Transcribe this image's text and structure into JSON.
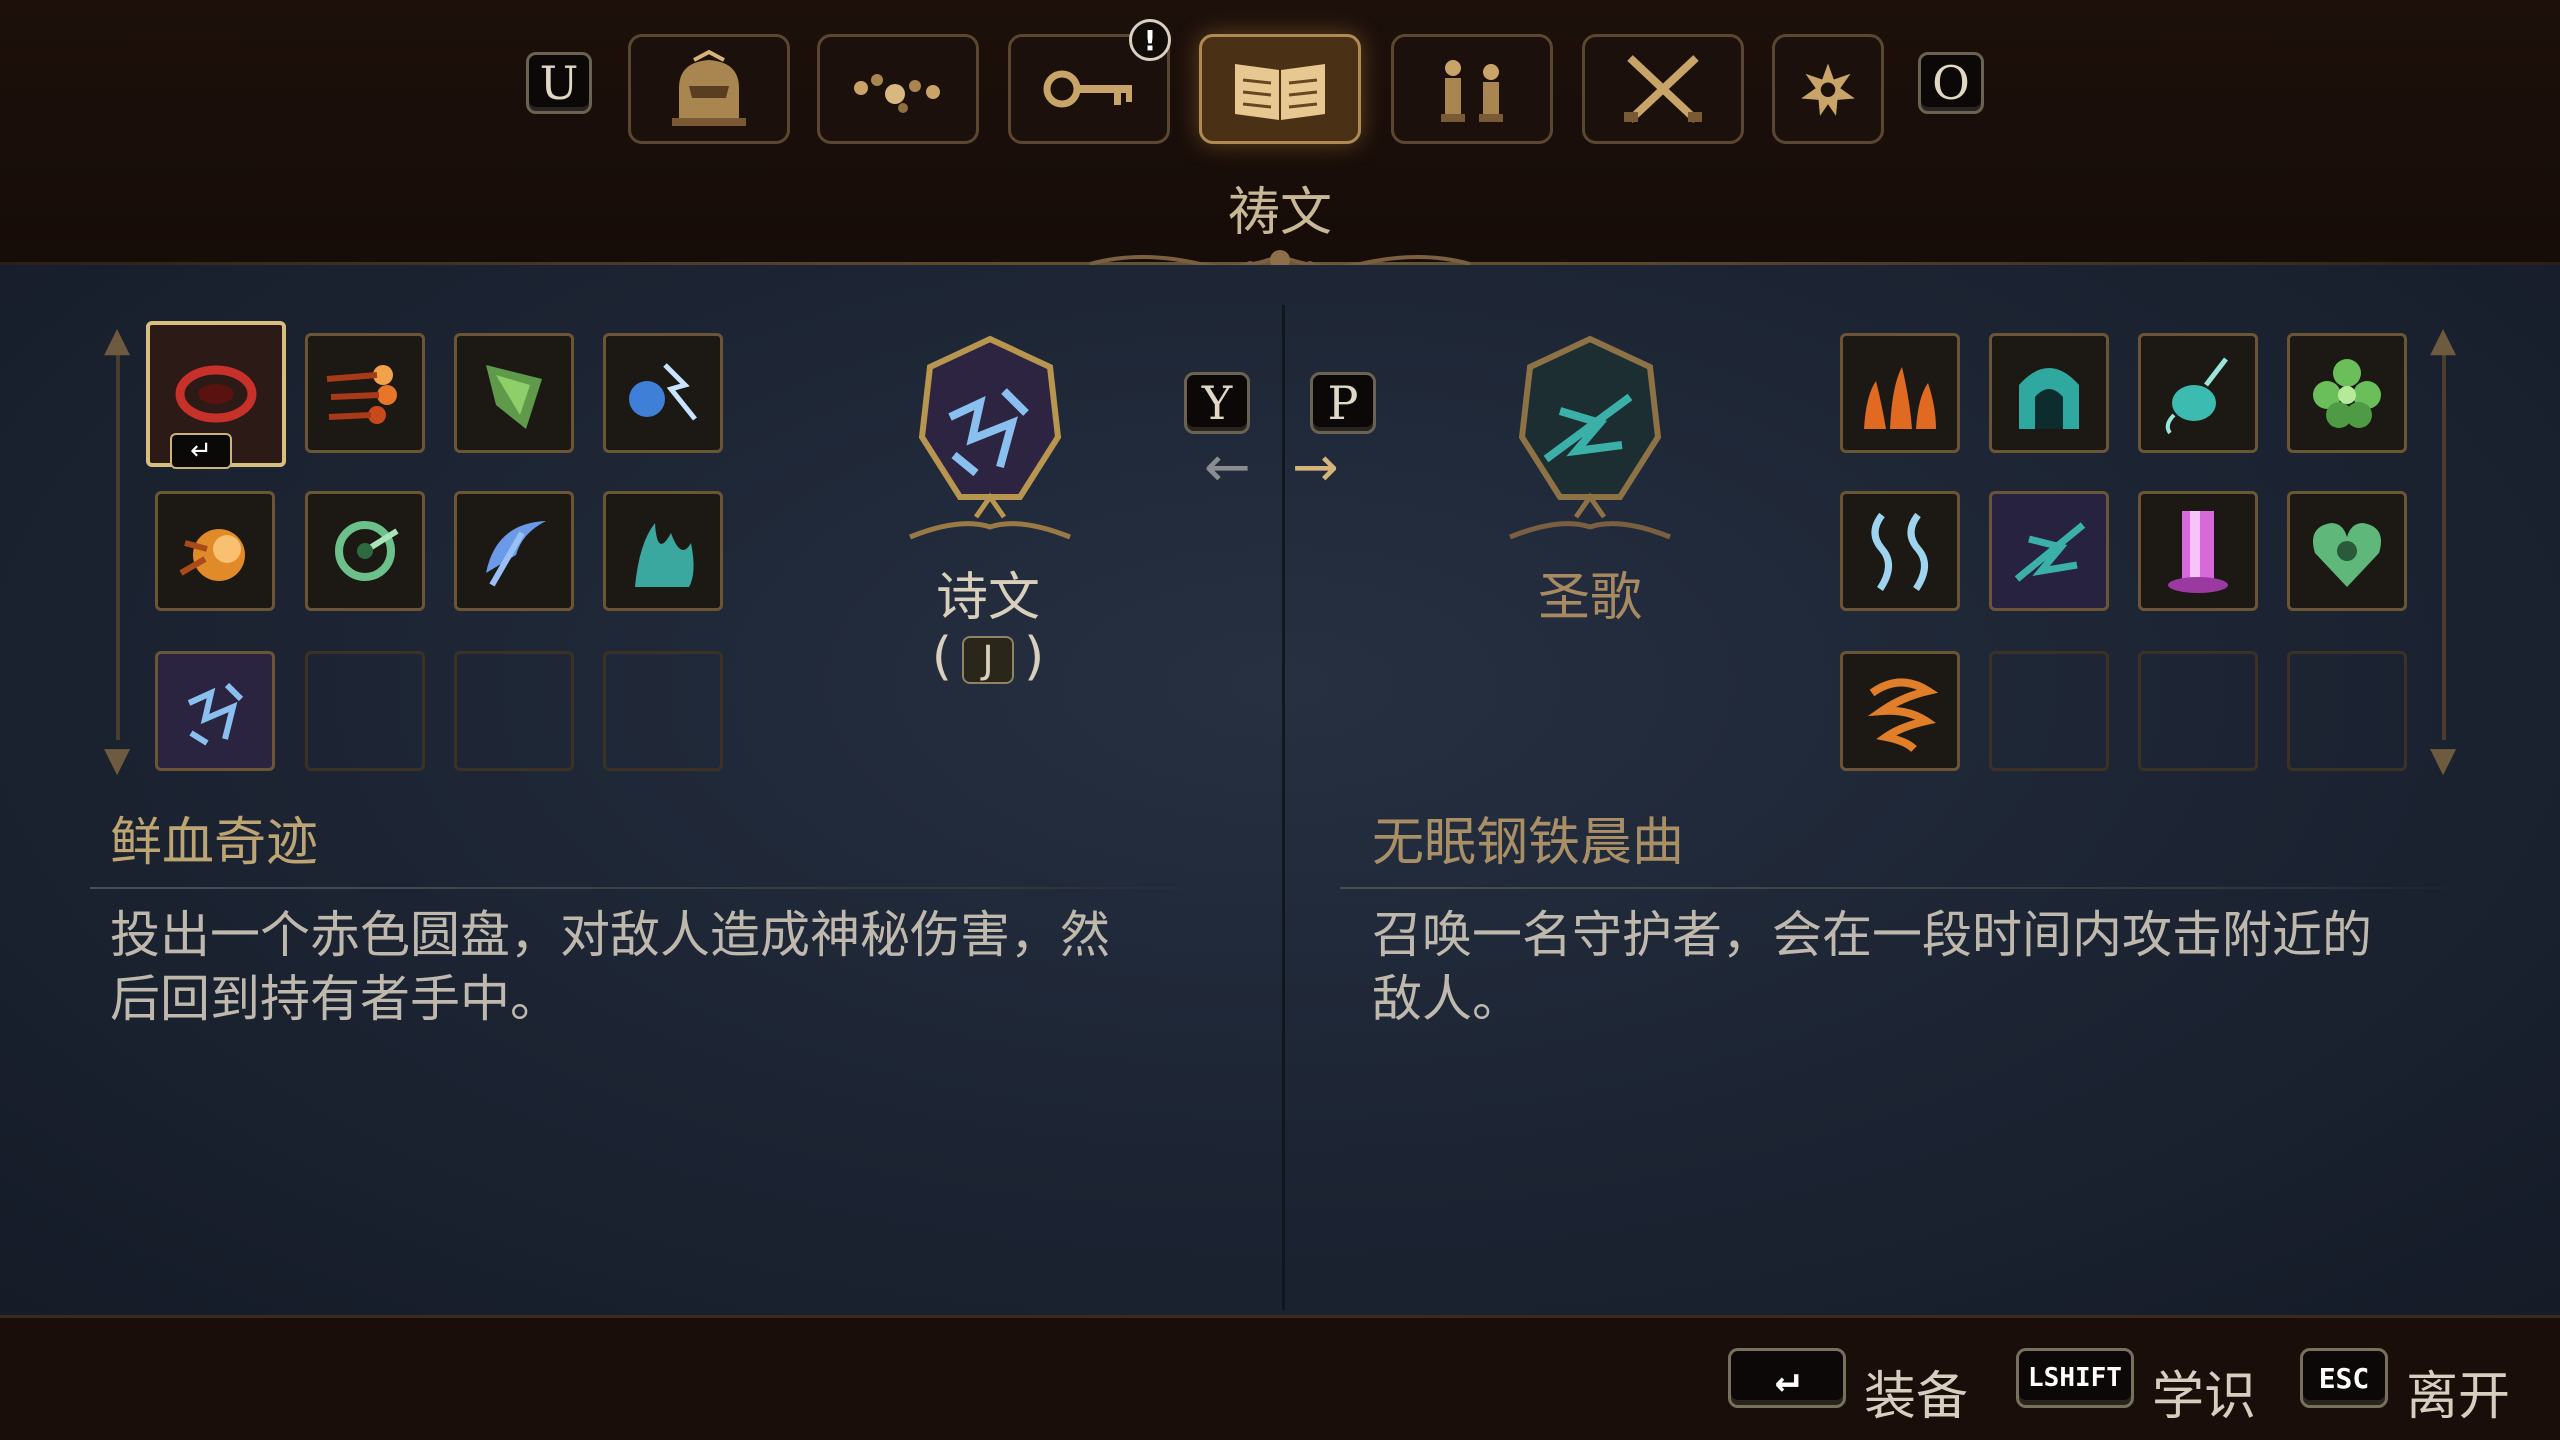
{
  "top_nav": {
    "left_key": "U",
    "right_key": "O",
    "tabs": [
      {
        "name": "character-tab",
        "icon": "helmet-icon",
        "active": false
      },
      {
        "name": "rosary-tab",
        "icon": "rosary-beads-icon",
        "active": false
      },
      {
        "name": "key-items-tab",
        "icon": "key-icon",
        "active": false,
        "alert": "!"
      },
      {
        "name": "verses-tab",
        "icon": "open-book-icon",
        "active": true
      },
      {
        "name": "figures-tab",
        "icon": "figurines-icon",
        "active": false
      },
      {
        "name": "weapons-tab",
        "icon": "crossed-swords-icon",
        "active": false
      },
      {
        "name": "options-tab",
        "icon": "gear-star-icon",
        "active": false
      }
    ],
    "active_title": "祷文"
  },
  "left_panel": {
    "grid": [
      {
        "icon": "red-disc-icon",
        "color": "#c8302a",
        "selected": true,
        "badge": "↵"
      },
      {
        "icon": "fire-bolts-icon",
        "color": "#e8762a"
      },
      {
        "icon": "green-shard-icon",
        "color": "#5e9a4a"
      },
      {
        "icon": "blue-lightning-icon",
        "color": "#3f7fd8"
      },
      {
        "icon": "orange-burst-icon",
        "color": "#e08a2a"
      },
      {
        "icon": "green-spiral-icon",
        "color": "#6cc08a"
      },
      {
        "icon": "blue-scythe-icon",
        "color": "#6a9ae8"
      },
      {
        "icon": "teal-flames-icon",
        "color": "#3ba8a0"
      },
      {
        "icon": "blue-rune-icon",
        "color": "#4a8ad8"
      },
      {
        "empty": true
      },
      {
        "empty": true
      },
      {
        "empty": true
      }
    ],
    "category_icon": "blue-rune-emblem-icon",
    "category_label": "诗文",
    "category_key": "J",
    "swap_key": "Y",
    "skill_name": "鲜血奇迹",
    "skill_desc_line1": "投出一个赤色圆盘，对敌人造成神秘伤害，然",
    "skill_desc_line2": "后回到持有者手中。",
    "colors": {
      "label": "#d8cfbc",
      "skill_name": "#bda473"
    }
  },
  "right_panel": {
    "swap_key": "P",
    "category_icon": "teal-guardian-emblem-icon",
    "category_label": "圣歌",
    "grid": [
      {
        "icon": "triple-flame-icon",
        "color": "#e06a22"
      },
      {
        "icon": "teal-shrine-icon",
        "color": "#2fa8a0"
      },
      {
        "icon": "teal-censer-icon",
        "color": "#3cbcb0"
      },
      {
        "icon": "green-flower-icon",
        "color": "#6abf5a"
      },
      {
        "icon": "twin-spirits-icon",
        "color": "#9fd4f0"
      },
      {
        "icon": "teal-guardian-icon",
        "color": "#3bb0a8"
      },
      {
        "icon": "magenta-pillar-icon",
        "color": "#d66ad8"
      },
      {
        "icon": "green-heart-icon",
        "color": "#5fb87a"
      },
      {
        "icon": "orange-vortex-icon",
        "color": "#e07e2a"
      },
      {
        "empty": true
      },
      {
        "empty": true
      },
      {
        "empty": true
      }
    ],
    "skill_name": "无眠钢铁晨曲",
    "skill_desc_line1": "召唤一名守护者，会在一段时间内攻击附近的",
    "skill_desc_line2": "敌人。",
    "colors": {
      "label": "#a88a62",
      "skill_name": "#a98f66"
    }
  },
  "bottom_hints": [
    {
      "key": "↵",
      "label": "装备"
    },
    {
      "key": "LSHIFT",
      "label": "学识"
    },
    {
      "key": "ESC",
      "label": "离开"
    }
  ]
}
